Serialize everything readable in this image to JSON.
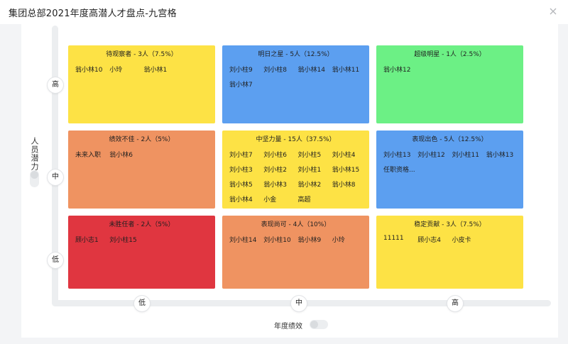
{
  "window": {
    "title": "集团总部2021年度高潜人才盘点-九宫格"
  },
  "axes": {
    "y_title": "人员潜力",
    "x_title": "年度绩效",
    "y_levels": [
      "高",
      "中",
      "低"
    ],
    "x_levels": [
      "低",
      "中",
      "高"
    ]
  },
  "colors": {
    "yellow": "#fde245",
    "blue": "#5c9ff0",
    "green": "#6cf085",
    "orange": "#ef9361",
    "red": "#e03640"
  },
  "grid": {
    "cells": [
      {
        "title": "待观察者 - 3人（7.5%）",
        "names": [
          "翁小林10",
          "小玲",
          "翁小林1"
        ]
      },
      {
        "title": "明日之星 - 5人（12.5%）",
        "names": [
          "刘小柱9",
          "刘小柱8",
          "翁小林14",
          "翁小林11",
          "翁小林7"
        ]
      },
      {
        "title": "超级明星 - 1人（2.5%）",
        "names": [
          "翁小林12"
        ]
      },
      {
        "title": "绩效不佳 - 2人（5%）",
        "names": [
          "未来入职",
          "翁小林6"
        ]
      },
      {
        "title": "中坚力量 - 15人（37.5%）",
        "names": [
          "刘小柱7",
          "刘小柱6",
          "刘小柱5",
          "刘小柱4",
          "刘小柱3",
          "刘小柱2",
          "刘小柱1",
          "翁小林15",
          "翁小林5",
          "翁小林3",
          "翁小林2",
          "翁小林8",
          "翁小林4",
          "小金",
          "高超"
        ]
      },
      {
        "title": "表现出色 - 5人（12.5%）",
        "names": [
          "刘小柱13",
          "刘小柱12",
          "刘小柱11",
          "翁小林13",
          "任职资格..."
        ]
      },
      {
        "title": "未胜任者 - 2人（5%）",
        "names": [
          "顾小志1",
          "刘小柱15"
        ]
      },
      {
        "title": "表现尚可 - 4人（10%）",
        "names": [
          "刘小柱14",
          "刘小柱10",
          "翁小林9",
          "小玲"
        ]
      },
      {
        "title": "稳定贡献 - 3人（7.5%）",
        "names": [
          "11111",
          "顾小志4",
          "小皮卡"
        ]
      }
    ]
  }
}
